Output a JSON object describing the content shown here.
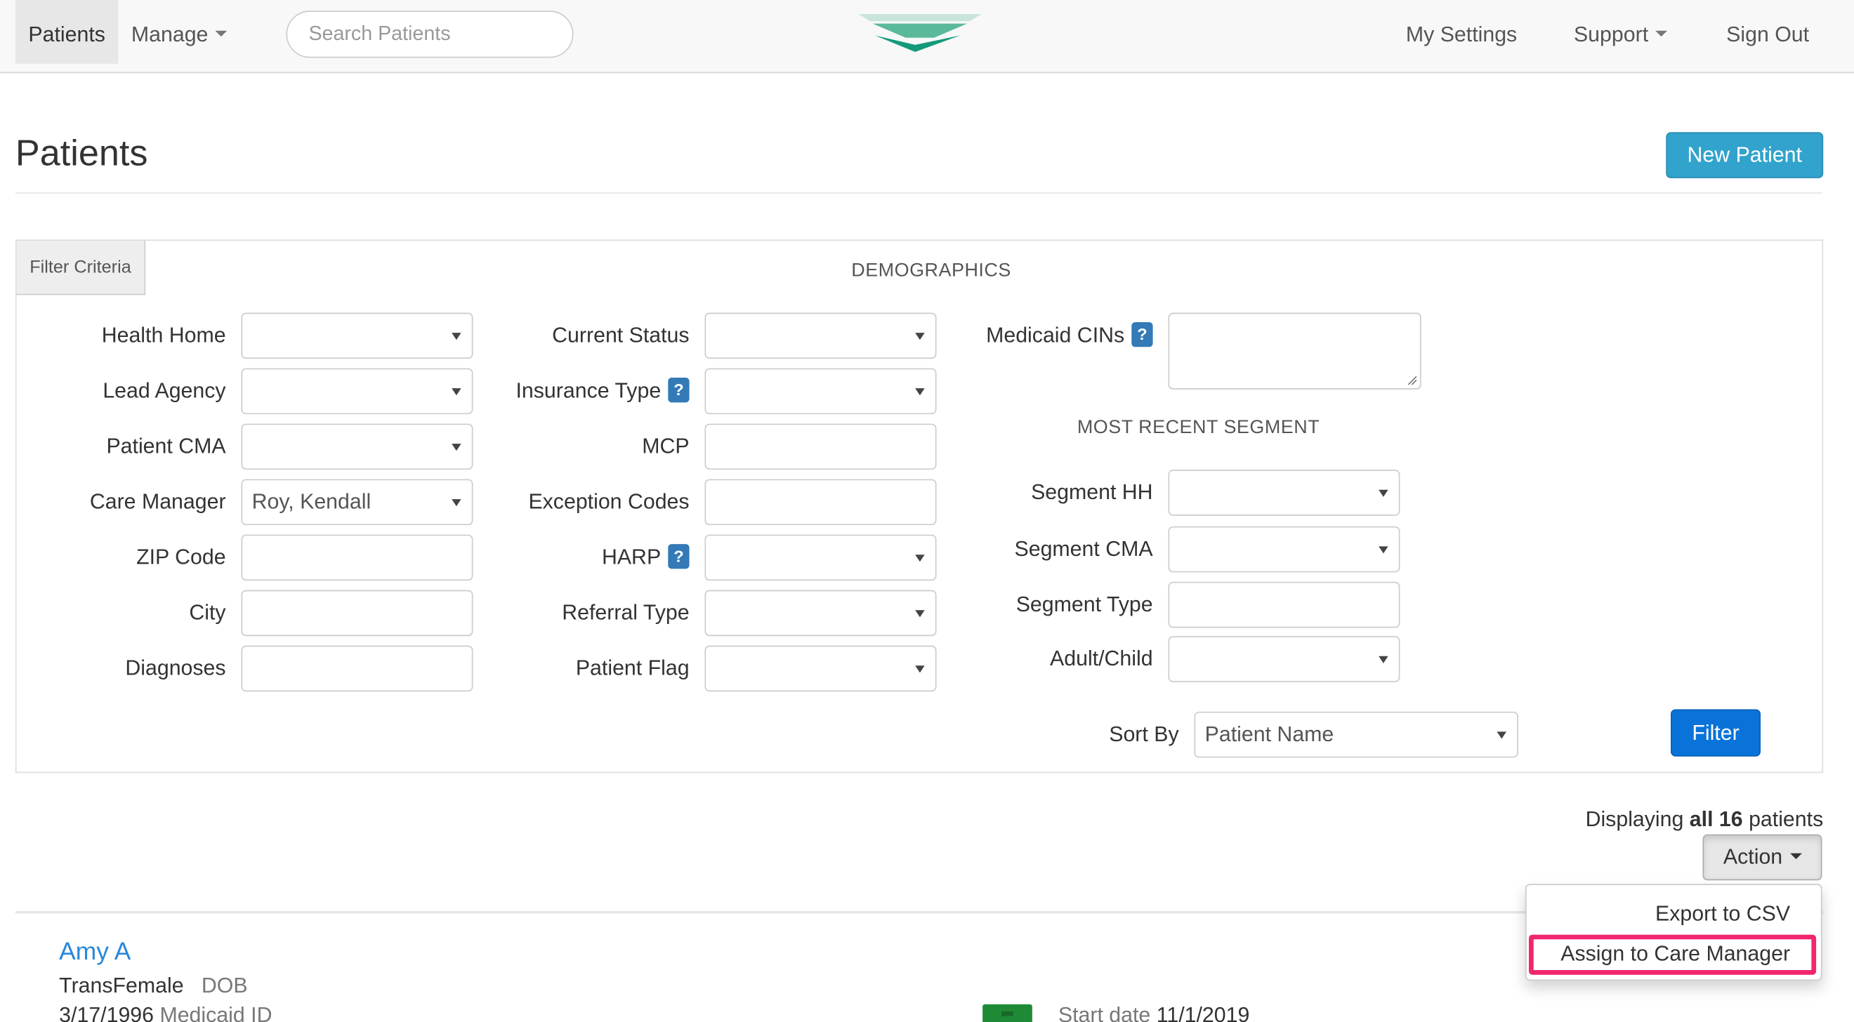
{
  "navbar": {
    "patients": "Patients",
    "manage": "Manage",
    "search_placeholder": "Search Patients",
    "my_settings": "My Settings",
    "support": "Support",
    "sign_out": "Sign Out",
    "logo_colors": [
      "#b8d9cf",
      "#5bb99b",
      "#149a7a"
    ]
  },
  "header": {
    "title": "Patients",
    "new_patient": "New Patient",
    "accent": "#31a3cc"
  },
  "filter": {
    "tab_label": "Filter Criteria",
    "demographics_heading": "DEMOGRAPHICS",
    "segment_heading": "MOST RECENT SEGMENT",
    "health_home": {
      "label": "Health Home",
      "value": ""
    },
    "lead_agency": {
      "label": "Lead Agency",
      "value": ""
    },
    "patient_cma": {
      "label": "Patient CMA",
      "value": ""
    },
    "care_manager": {
      "label": "Care Manager",
      "value": "Roy, Kendall"
    },
    "zip_code": {
      "label": "ZIP Code",
      "value": ""
    },
    "city": {
      "label": "City",
      "value": ""
    },
    "diagnoses": {
      "label": "Diagnoses",
      "value": ""
    },
    "current_status": {
      "label": "Current Status",
      "value": ""
    },
    "insurance_type": {
      "label": "Insurance Type",
      "value": ""
    },
    "mcp": {
      "label": "MCP",
      "value": ""
    },
    "exception_codes": {
      "label": "Exception Codes",
      "value": ""
    },
    "harp": {
      "label": "HARP",
      "value": ""
    },
    "referral_type": {
      "label": "Referral Type",
      "value": ""
    },
    "patient_flag": {
      "label": "Patient Flag",
      "value": ""
    },
    "medicaid_cins": {
      "label": "Medicaid CINs",
      "value": ""
    },
    "segment_hh": {
      "label": "Segment HH",
      "value": ""
    },
    "segment_cma": {
      "label": "Segment CMA",
      "value": ""
    },
    "segment_type": {
      "label": "Segment Type",
      "value": ""
    },
    "adult_child": {
      "label": "Adult/Child",
      "value": ""
    },
    "sort_by": {
      "label": "Sort By",
      "value": "Patient Name"
    },
    "filter_button": "Filter",
    "help_glyph": "?"
  },
  "results": {
    "displaying_prefix": "Displaying ",
    "displaying_bold": "all 16",
    "displaying_suffix": " patients",
    "action_button": "Action",
    "menu": {
      "export_csv": "Export to CSV",
      "assign_care_manager": "Assign to Care Manager",
      "highlight_color": "#f0266e"
    },
    "patient": {
      "name": "Amy A",
      "gender": "TransFemale",
      "dob_label": "DOB",
      "dob": "3/17/1996",
      "medicaid_label": "Medicaid ID",
      "start_label": "Start date",
      "start_date": "11/1/2019"
    }
  }
}
